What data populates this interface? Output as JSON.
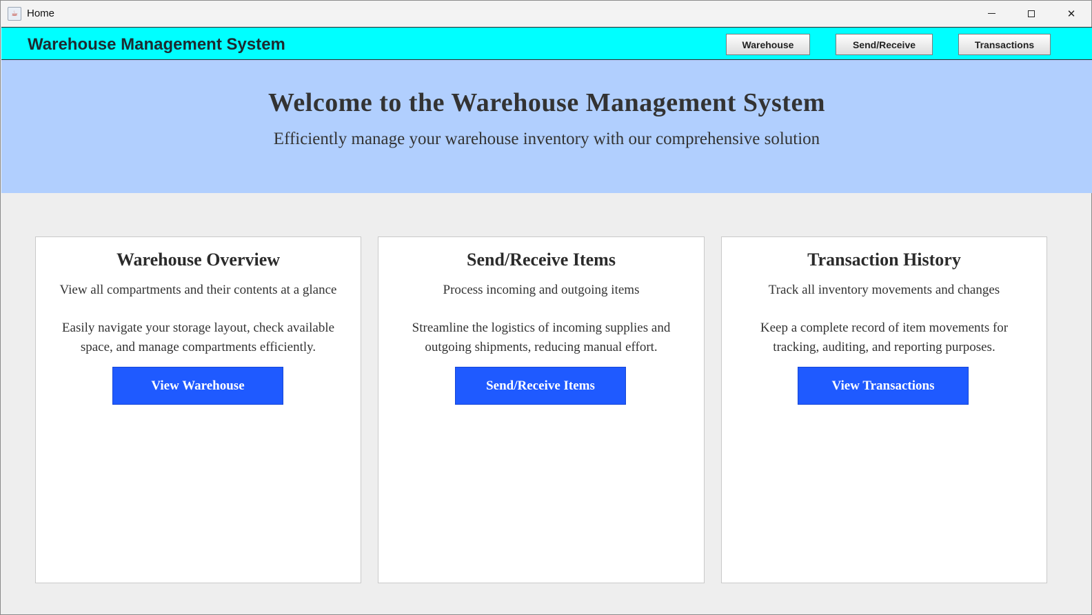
{
  "window": {
    "title": "Home",
    "icon": "java-cup-icon",
    "controls": {
      "minimize": "minimize-icon",
      "maximize": "maximize-icon",
      "close": "✕"
    }
  },
  "header": {
    "title": "Warehouse Management System",
    "background": "#00ffff",
    "nav": {
      "warehouse": "Warehouse",
      "send_receive": "Send/Receive",
      "transactions": "Transactions"
    }
  },
  "hero": {
    "title": "Welcome to the Warehouse Management System",
    "subtitle": "Efficiently manage your warehouse inventory with our comprehensive solution",
    "background": "#b1cffe"
  },
  "cards": [
    {
      "title": "Warehouse Overview",
      "subtitle": "View all compartments and their contents at a glance",
      "description": "Easily navigate your storage layout, check available space, and manage compartments efficiently.",
      "button": "View Warehouse"
    },
    {
      "title": "Send/Receive Items",
      "subtitle": "Process incoming and outgoing items",
      "description": "Streamline the logistics of incoming supplies and outgoing shipments, reducing manual effort.",
      "button": "Send/Receive Items"
    },
    {
      "title": "Transaction History",
      "subtitle": "Track all inventory movements and changes",
      "description": "Keep a complete record of item movements for tracking, auditing, and reporting purposes.",
      "button": "View Transactions"
    }
  ],
  "colors": {
    "accent_button": "#1f5aff",
    "page_background": "#eeeeee"
  }
}
